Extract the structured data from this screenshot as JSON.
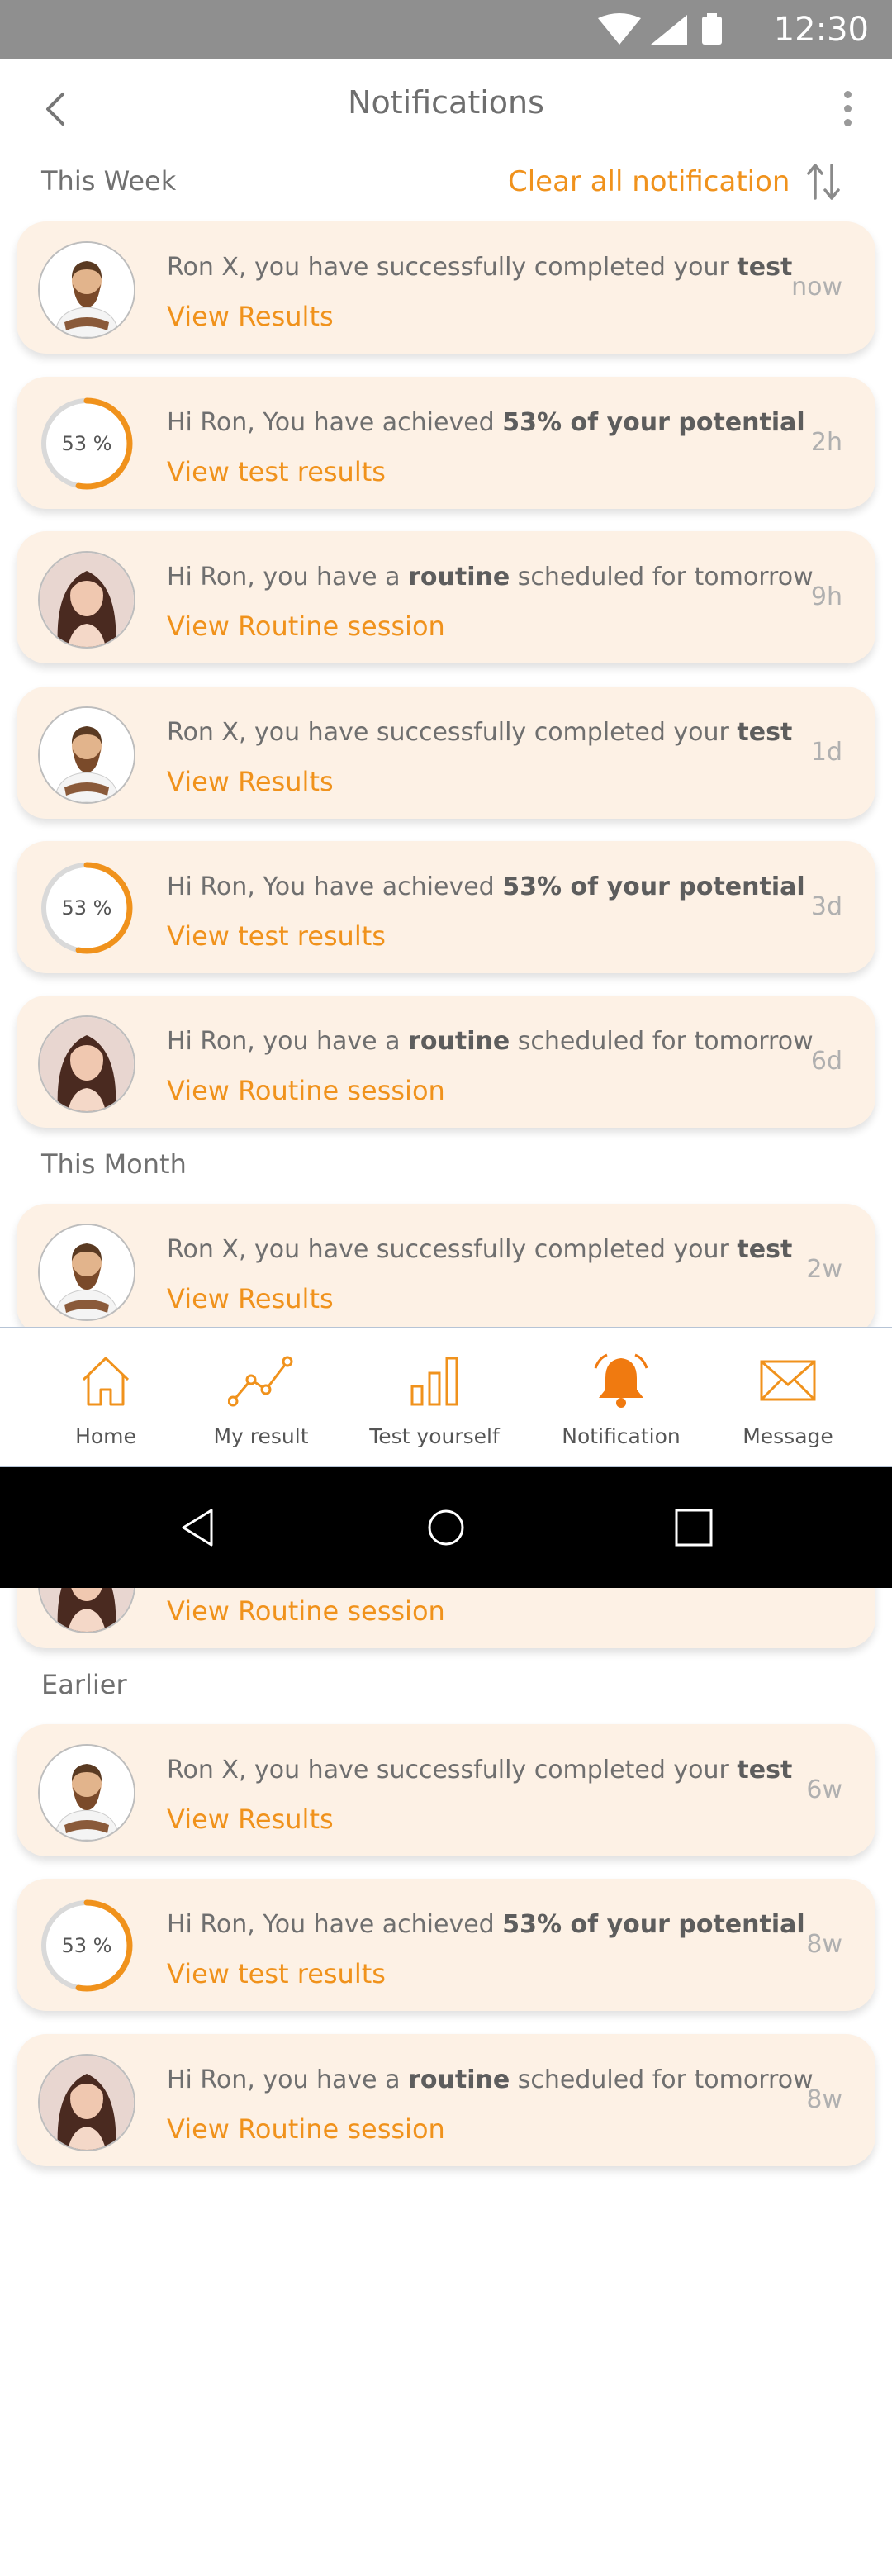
{
  "status_bar": {
    "time": "12:30"
  },
  "header": {
    "title": "Notifications"
  },
  "toolbar": {
    "clear_all": "Clear all  notification"
  },
  "sections": {
    "this_week": "This Week",
    "this_month": "This Month",
    "earlier": "Earlier"
  },
  "notifications": [
    {
      "type": "test",
      "message": [
        "Ron X, you have successfully completed your ",
        "test",
        ""
      ],
      "link": "View Results",
      "time": "now"
    },
    {
      "type": "potential",
      "ring": "53 %",
      "percent": 0.53,
      "message": [
        "Hi Ron, You have achieved ",
        "53% of your potential",
        ""
      ],
      "link": "View test results",
      "time": "2h"
    },
    {
      "type": "routine",
      "message": [
        "Hi Ron, you have a ",
        "routine",
        " scheduled for tomorrow"
      ],
      "link": "View Routine session",
      "time": "9h"
    },
    {
      "type": "test",
      "message": [
        "Ron X, you have successfully completed your ",
        "test",
        ""
      ],
      "link": "View Results",
      "time": "1d"
    },
    {
      "type": "potential",
      "ring": "53 %",
      "percent": 0.53,
      "message": [
        "Hi Ron, You have achieved ",
        "53% of your potential",
        ""
      ],
      "link": "View test results",
      "time": "3d"
    },
    {
      "type": "routine",
      "message": [
        "Hi Ron, you have a ",
        "routine",
        " scheduled for tomorrow"
      ],
      "link": "View Routine session",
      "time": "6d"
    },
    {
      "type": "test",
      "message": [
        "Ron X, you have successfully completed your ",
        "test",
        ""
      ],
      "link": "View Results",
      "time": "2w"
    },
    {
      "type": "routine",
      "message": [
        "",
        "",
        ""
      ],
      "link": "View Routine session",
      "time": ""
    },
    {
      "type": "test",
      "message": [
        "Ron X, you have successfully completed your ",
        "test",
        ""
      ],
      "link": "View Results",
      "time": "6w"
    },
    {
      "type": "potential",
      "ring": "53 %",
      "percent": 0.53,
      "message": [
        "Hi Ron, You have achieved ",
        "53% of your potential",
        ""
      ],
      "link": "View test results",
      "time": "8w"
    },
    {
      "type": "routine",
      "message": [
        "Hi Ron, you have a ",
        "routine",
        " scheduled for tomorrow"
      ],
      "link": "View Routine session",
      "time": "8w"
    }
  ],
  "bottom_nav": [
    {
      "label": "Home",
      "icon": "home-icon",
      "active": false
    },
    {
      "label": "My result",
      "icon": "chart-line-icon",
      "active": false
    },
    {
      "label": "Test yourself",
      "icon": "bar-chart-icon",
      "active": false
    },
    {
      "label": "Notification",
      "icon": "bell-icon",
      "active": true
    },
    {
      "label": "Message",
      "icon": "envelope-icon",
      "active": false
    }
  ],
  "colors": {
    "accent": "#f0921c",
    "card_bg": "#fdf1e5",
    "status_bar": "#8f8f8f"
  }
}
